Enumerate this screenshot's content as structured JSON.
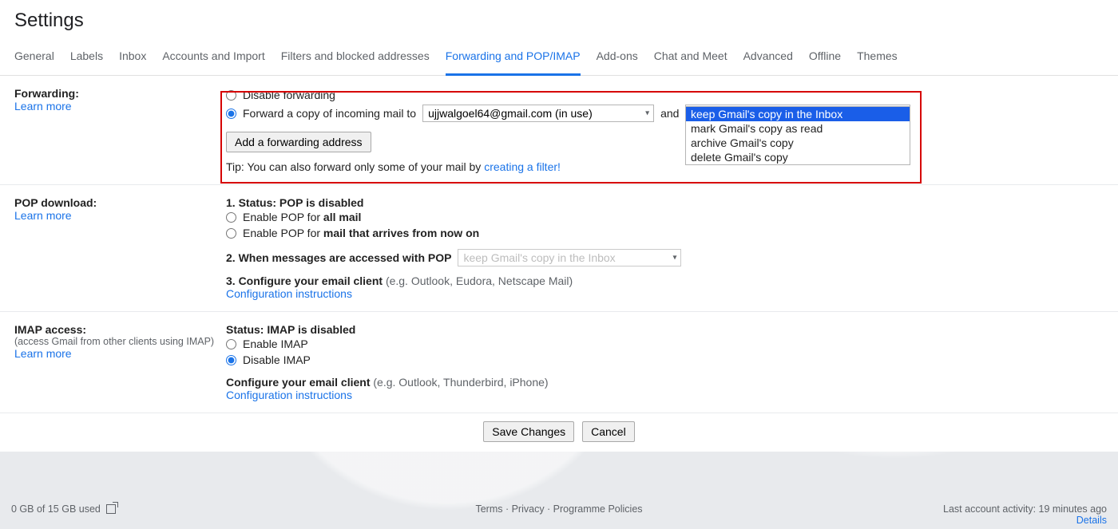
{
  "title": "Settings",
  "tabs": [
    "General",
    "Labels",
    "Inbox",
    "Accounts and Import",
    "Filters and blocked addresses",
    "Forwarding and POP/IMAP",
    "Add-ons",
    "Chat and Meet",
    "Advanced",
    "Offline",
    "Themes"
  ],
  "active_tab_index": 5,
  "forwarding": {
    "label": "Forwarding:",
    "learn_more": "Learn more",
    "disable_label": "Disable forwarding",
    "forward_label_prefix": "Forward a copy of incoming mail to",
    "and_text": "and",
    "address_selected": "ujjwalgoel64@gmail.com (in use)",
    "action_selected": "keep Gmail's copy in the Inbox",
    "action_options": [
      "keep Gmail's copy in the Inbox",
      "mark Gmail's copy as read",
      "archive Gmail's copy",
      "delete Gmail's copy"
    ],
    "add_address_btn": "Add a forwarding address",
    "tip_prefix": "Tip: You can also forward only some of your mail by ",
    "tip_link": "creating a filter!"
  },
  "pop": {
    "label": "POP download:",
    "learn_more": "Learn more",
    "status_prefix": "1. Status: ",
    "status_value": "POP is disabled",
    "enable_all_prefix": "Enable POP for ",
    "enable_all_bold": "all mail",
    "enable_now_prefix": "Enable POP for ",
    "enable_now_bold": "mail that arrives from now on",
    "accessed_label": "2. When messages are accessed with POP",
    "accessed_value": "keep Gmail's copy in the Inbox",
    "configure_prefix": "3. Configure your email client ",
    "configure_eg": "(e.g. Outlook, Eudora, Netscape Mail)",
    "configure_link": "Configuration instructions"
  },
  "imap": {
    "label": "IMAP access:",
    "sub": "(access Gmail from other clients using IMAP)",
    "learn_more": "Learn more",
    "status_prefix": "Status: ",
    "status_value": "IMAP is disabled",
    "enable_label": "Enable IMAP",
    "disable_label": "Disable IMAP",
    "configure_prefix": "Configure your email client ",
    "configure_eg": "(e.g. Outlook, Thunderbird, iPhone)",
    "configure_link": "Configuration instructions"
  },
  "buttons": {
    "save": "Save Changes",
    "cancel": "Cancel"
  },
  "footer": {
    "storage": "0 GB of 15 GB used",
    "links": "Terms · Privacy · Programme Policies",
    "activity": "Last account activity: 19 minutes ago",
    "details": "Details"
  }
}
